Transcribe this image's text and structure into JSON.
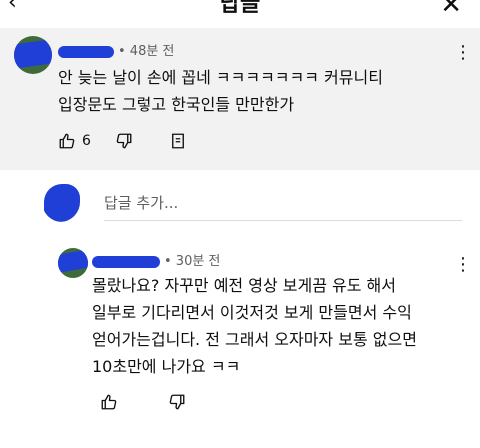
{
  "header": {
    "title": "답글",
    "close_glyph": "✕",
    "back_glyph": "‹"
  },
  "parent_comment": {
    "timestamp": "• 48분 전",
    "text": "안 늦는 날이 손에 꼽네 ㅋㅋㅋㅋㅋㅋㅋ 커뮤니티\n입장문도 그렇고 한국인들 만만한가",
    "like_count": "6",
    "icons": [
      "thumbs-up-icon",
      "thumbs-down-icon",
      "reply-icon",
      "more-vert-icon"
    ]
  },
  "reply_box": {
    "placeholder": "답글 추가..."
  },
  "child_comment": {
    "timestamp": "• 30분 전",
    "text": "몰랐나요? 자꾸만 예전 영상 보게끔 유도 해서\n일부로 기다리면서 이것저것 보게 만들면서 수익\n얻어가는겁니다. 전 그래서 오자마자 보통 없으면\n10초만에 나가요 ㅋㅋ",
    "icons": [
      "thumbs-up-icon",
      "thumbs-down-icon",
      "more-vert-icon"
    ]
  },
  "colors": {
    "parent_bg": "#f2f2f2",
    "meta_text": "#606060",
    "redaction": "#1f3fd6"
  }
}
